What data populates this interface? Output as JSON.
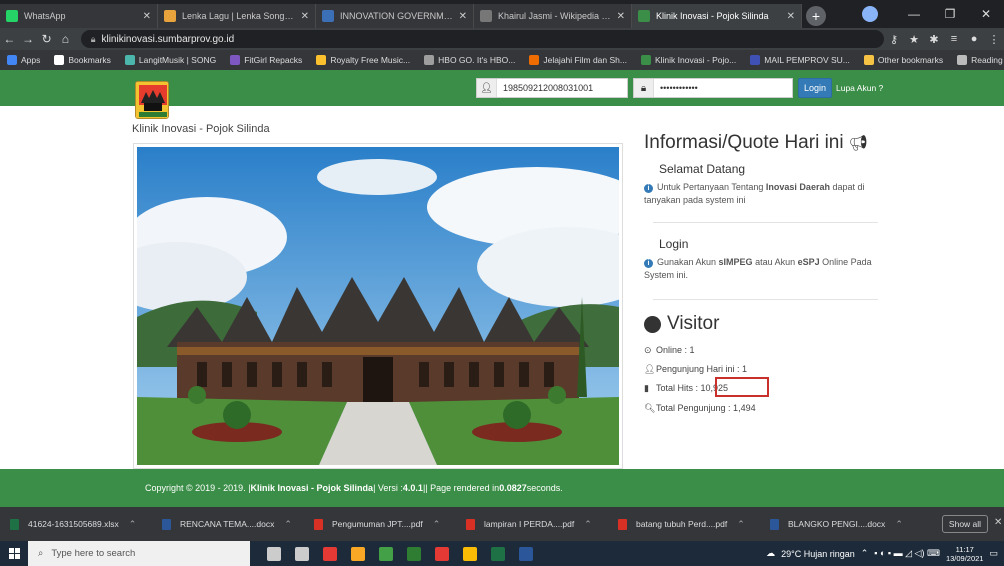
{
  "browser": {
    "tabs": [
      {
        "title": "WhatsApp",
        "color": "#25d366",
        "glyph": "W"
      },
      {
        "title": "Lenka Lagu | Lenka Songs Down",
        "color": "#e8a33d",
        "glyph": "L"
      },
      {
        "title": "INNOVATION GOVERNMENT AV",
        "color": "#3b6fb6",
        "glyph": "I"
      },
      {
        "title": "Khairul Jasmi - Wikipedia bahasa",
        "color": "#777777",
        "glyph": "W"
      },
      {
        "title": "Klinik Inovasi - Pojok Silinda",
        "color": "#3b8e47",
        "glyph": "K"
      }
    ],
    "url": "klinikinovasi.sumbarprov.go.id",
    "bookmarks": [
      {
        "label": "Apps",
        "color": "#4285f4"
      },
      {
        "label": "Bookmarks",
        "color": "#ffffff"
      },
      {
        "label": "LangitMusik | SONG",
        "color": "#4db6ac"
      },
      {
        "label": "FitGirl Repacks",
        "color": "#7e57c2"
      },
      {
        "label": "Royalty Free Music...",
        "color": "#fbc02d"
      },
      {
        "label": "HBO GO. It's HBO...",
        "color": "#9e9e9e"
      },
      {
        "label": "Jelajahi Film dan Sh...",
        "color": "#ef6c00"
      },
      {
        "label": "Klinik Inovasi - Pojo...",
        "color": "#3b8e47"
      },
      {
        "label": "MAIL PEMPROV SU...",
        "color": "#3f51b5"
      }
    ],
    "bookmarks_right": [
      {
        "label": "Other bookmarks",
        "color": "#f6c344"
      },
      {
        "label": "Reading list",
        "color": "#bbbbbb"
      }
    ]
  },
  "header": {
    "nip_value": "198509212008031001",
    "password_value": "••••••••••••",
    "login_label": "Login",
    "forgot_label": "Lupa Akun ?"
  },
  "main": {
    "site_name": "Klinik Inovasi - Pojok Silinda"
  },
  "info": {
    "title": "Informasi/Quote Hari ini",
    "welcome_title": "Selamat Datang",
    "welcome_pre": "Untuk Pertanyaan Tentang ",
    "welcome_bold": "Inovasi Daerah",
    "welcome_post": " dapat di tanyakan pada system ini",
    "login_title": "Login",
    "login_pre": "Gunakan Akun ",
    "login_bold1": "sIMPEG",
    "login_mid": " atau Akun ",
    "login_bold2": "eSPJ",
    "login_post": " Online Pada System ini."
  },
  "visitor": {
    "title": "Visitor",
    "online": "Online : 1",
    "today": "Pengunjung Hari ini : 1",
    "hits": "Total Hits : 10,925",
    "total": "Total Pengunjung : 1,494"
  },
  "footer": {
    "copyright": "Copyright © 2019 - 2019. | ",
    "bold1": "Klinik Inovasi - Pojok Silinda",
    "version_pre": " | Versi : ",
    "version": "4.0.1",
    "render_pre": " || Page rendered in ",
    "render_time": "0.0827",
    "render_post": " seconds."
  },
  "downloads": {
    "items": [
      {
        "name": "41624-1631505689.xlsx",
        "color": "#1e7145"
      },
      {
        "name": "RENCANA TEMA....docx",
        "color": "#2b579a"
      },
      {
        "name": "Pengumuman JPT....pdf",
        "color": "#d93025"
      },
      {
        "name": "lampiran I PERDA....pdf",
        "color": "#d93025"
      },
      {
        "name": "batang tubuh Perd....pdf",
        "color": "#d93025"
      },
      {
        "name": "BLANGKO PENGI....docx",
        "color": "#2b579a"
      }
    ],
    "show_all": "Show all"
  },
  "taskbar": {
    "search_placeholder": "Type here to search",
    "weather": "29°C  Hujan ringan",
    "time": "11:17",
    "date": "13/09/2021",
    "apps": [
      "#cccccc",
      "#cccccc",
      "#e53935",
      "#f9a825",
      "#43a047",
      "#2e7d32",
      "#e53935",
      "#fbbc05",
      "#1e7145",
      "#2b579a"
    ]
  }
}
